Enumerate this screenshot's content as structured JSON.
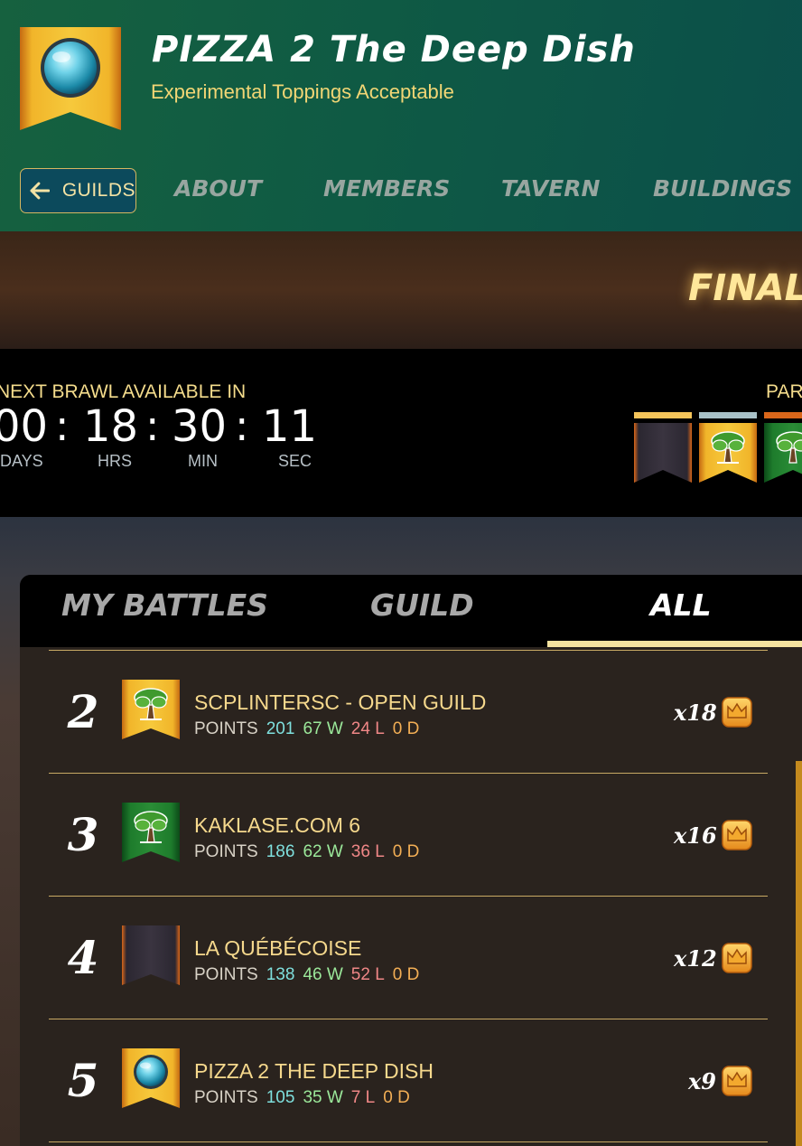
{
  "guild": {
    "title": "PIZZA 2 The Deep Dish",
    "subtitle": "Experimental Toppings Acceptable",
    "banner_icon": "crystal-orb-icon"
  },
  "nav": {
    "back_label": "GUILDS",
    "tabs": [
      {
        "label": "ABOUT"
      },
      {
        "label": "MEMBERS"
      },
      {
        "label": "TAVERN"
      },
      {
        "label": "BUILDINGS"
      }
    ]
  },
  "brawl": {
    "stage_label": "FINAL",
    "next_label": "NEXT BRAWL AVAILABLE IN",
    "timer": {
      "days": "00",
      "hours": "18",
      "minutes": "30",
      "seconds": "11",
      "sep": ":",
      "units": [
        "DAYS",
        "HRS",
        "MIN",
        "SEC"
      ]
    },
    "participants_label": "PAR"
  },
  "battles": {
    "tabs": [
      {
        "label": "MY BATTLES"
      },
      {
        "label": "GUILD"
      },
      {
        "label": "ALL",
        "active": true
      }
    ],
    "rows": [
      {
        "rank": "2",
        "name": "SCPLINTERSC - OPEN GUILD",
        "points_label": "POINTS",
        "points": "201",
        "wins": "67 W",
        "losses": "24 L",
        "draws": "0 D",
        "multiplier": "x18",
        "flag_icon": "tree-icon"
      },
      {
        "rank": "3",
        "name": "KAKLASE.COM 6",
        "points_label": "POINTS",
        "points": "186",
        "wins": "62 W",
        "losses": "36 L",
        "draws": "0 D",
        "multiplier": "x16",
        "flag_icon": "tree-icon"
      },
      {
        "rank": "4",
        "name": "LA QUÉBÉCOISE",
        "points_label": "POINTS",
        "points": "138",
        "wins": "46 W",
        "losses": "52 L",
        "draws": "0 D",
        "multiplier": "x12",
        "flag_icon": "blank-banner-icon"
      },
      {
        "rank": "5",
        "name": "PIZZA 2 THE DEEP DISH",
        "points_label": "POINTS",
        "points": "105",
        "wins": "35 W",
        "losses": "7 L",
        "draws": "0 D",
        "multiplier": "x9",
        "flag_icon": "crystal-orb-icon"
      }
    ]
  },
  "colors": {
    "header_green": "#0f5a44",
    "gold_text": "#f6d98d",
    "active_tab_underline": "#f5e3a0",
    "points_teal": "#7fe0de",
    "wins_green": "#9be89a",
    "losses_red": "#f08787",
    "draws_orange": "#f2ae55"
  }
}
